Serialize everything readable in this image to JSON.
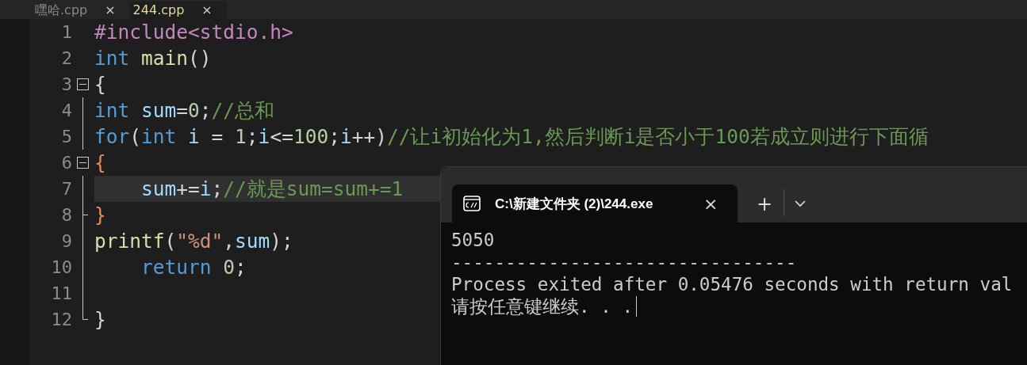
{
  "editor_tabs": [
    {
      "label": "嘿哈.cpp",
      "close": "×",
      "selected": false
    },
    {
      "label": "244.cpp",
      "close": "×",
      "selected": true
    }
  ],
  "code_lines": [
    {
      "number": "1",
      "current": false,
      "tokens": [
        {
          "kind": "preproc",
          "text": "#include<stdio.h>"
        }
      ]
    },
    {
      "number": "2",
      "current": false,
      "tokens": [
        {
          "kind": "keyword",
          "text": "int "
        },
        {
          "kind": "function",
          "text": "main"
        },
        {
          "kind": "punct",
          "text": "()"
        }
      ]
    },
    {
      "number": "3",
      "fold": {
        "kind": "start"
      },
      "current": false,
      "tokens": [
        {
          "kind": "punct",
          "text": "{"
        }
      ]
    },
    {
      "number": "4",
      "fold": {
        "kind": "line"
      },
      "current": false,
      "tokens": [
        {
          "kind": "keyword",
          "text": "int "
        },
        {
          "kind": "variable",
          "text": "sum"
        },
        {
          "kind": "punct",
          "text": "="
        },
        {
          "kind": "number",
          "text": "0"
        },
        {
          "kind": "punct",
          "text": ";"
        },
        {
          "kind": "comment",
          "text": "//总和"
        }
      ]
    },
    {
      "number": "5",
      "fold": {
        "kind": "line"
      },
      "current": false,
      "tokens": [
        {
          "kind": "keyword",
          "text": "for"
        },
        {
          "kind": "punct",
          "text": "("
        },
        {
          "kind": "keyword",
          "text": "int "
        },
        {
          "kind": "variable",
          "text": "i"
        },
        {
          "kind": "punct",
          "text": " = "
        },
        {
          "kind": "number",
          "text": "1"
        },
        {
          "kind": "punct",
          "text": ";"
        },
        {
          "kind": "variable",
          "text": "i"
        },
        {
          "kind": "punct",
          "text": "<="
        },
        {
          "kind": "number",
          "text": "100"
        },
        {
          "kind": "punct",
          "text": ";"
        },
        {
          "kind": "variable",
          "text": "i"
        },
        {
          "kind": "punct",
          "text": "++)"
        },
        {
          "kind": "comment",
          "text": "//让i初始化为1,然后判断i是否小于100若成立则进行下面循"
        }
      ]
    },
    {
      "number": "6",
      "fold": {
        "kind": "start"
      },
      "current": false,
      "tokens": [
        {
          "kind": "brace",
          "text": "{"
        }
      ]
    },
    {
      "number": "7",
      "fold": {
        "kind": "line"
      },
      "current": true,
      "indent": true,
      "tokens": [
        {
          "kind": "variable",
          "text": "sum"
        },
        {
          "kind": "punct",
          "text": "+="
        },
        {
          "kind": "variable",
          "text": "i"
        },
        {
          "kind": "punct",
          "text": ";"
        },
        {
          "kind": "comment",
          "text": "//就是sum=sum+=1"
        }
      ]
    },
    {
      "number": "8",
      "fold": {
        "kind": "branch"
      },
      "current": false,
      "tokens": [
        {
          "kind": "brace",
          "text": "}"
        }
      ]
    },
    {
      "number": "9",
      "fold": {
        "kind": "line"
      },
      "current": false,
      "tokens": [
        {
          "kind": "function",
          "text": "printf"
        },
        {
          "kind": "punct",
          "text": "("
        },
        {
          "kind": "string",
          "text": "\"%d\""
        },
        {
          "kind": "punct",
          "text": ","
        },
        {
          "kind": "variable",
          "text": "sum"
        },
        {
          "kind": "punct",
          "text": ");"
        }
      ]
    },
    {
      "number": "10",
      "fold": {
        "kind": "line"
      },
      "current": false,
      "indent": true,
      "tokens": [
        {
          "kind": "keyword",
          "text": "return "
        },
        {
          "kind": "number",
          "text": "0"
        },
        {
          "kind": "punct",
          "text": ";"
        }
      ]
    },
    {
      "number": "11",
      "fold": {
        "kind": "line"
      },
      "current": false
    },
    {
      "number": "12",
      "fold": {
        "kind": "end"
      },
      "current": false,
      "tokens": [
        {
          "kind": "punct",
          "text": "}"
        }
      ]
    }
  ],
  "terminal": {
    "tab_title": "C:\\新建文件夹 (2)\\244.exe",
    "tab_close": "×",
    "new_tab": "+",
    "output": [
      "5050",
      "--------------------------------",
      "Process exited after 0.05476 seconds with return val",
      "请按任意键继续. . ."
    ]
  }
}
